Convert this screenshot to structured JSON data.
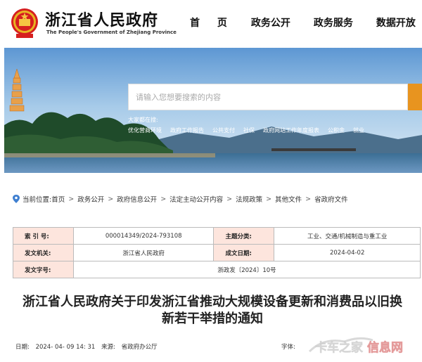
{
  "header": {
    "brand_cn": "浙江省人民政府",
    "brand_en": "The People's Government of Zhejiang Province",
    "nav": [
      "首 页",
      "政务公开",
      "政务服务",
      "数据开放"
    ]
  },
  "search": {
    "placeholder": "请输入您想要搜索的内容",
    "hot_title": "大家都在搜:",
    "hot_links": [
      "优化营商环境",
      "政府工作报告",
      "公共支付",
      "社保",
      "政府网站工作年度报表",
      "公积金",
      "就业"
    ],
    "button_color": "#e8941f"
  },
  "breadcrumb": {
    "prefix": "当前位置:",
    "items": [
      "首页",
      "政务公开",
      "政府信息公开",
      "法定主动公开内容",
      "法规政策",
      "其他文件",
      "省政府文件"
    ],
    "separator": ">"
  },
  "info_table": {
    "index_label": "索 引 号:",
    "index_value": "000014349/2024-793108",
    "category_label": "主题分类:",
    "category_value": "工业、交通/机械制造与重工业",
    "issuer_label": "发文机关:",
    "issuer_value": "浙江省人民政府",
    "date_label": "成文日期:",
    "date_value": "2024-04-02",
    "docno_label": "发文字号:",
    "docno_value": "浙政发〔2024〕10号",
    "label_bg": "#fde5dd"
  },
  "document": {
    "title_line1": "浙江省人民政府关于印发浙江省推动大规模设备更新和消费品以旧换",
    "title_line2": "新若干举措的通知"
  },
  "meta": {
    "date_label": "日期:",
    "date_value": "2024- 04- 09 14: 31",
    "source_label": "来源:",
    "source_value": "省政府办公厅",
    "font_label": "字体:"
  },
  "watermark": {
    "text": "卡车之家信息网"
  }
}
